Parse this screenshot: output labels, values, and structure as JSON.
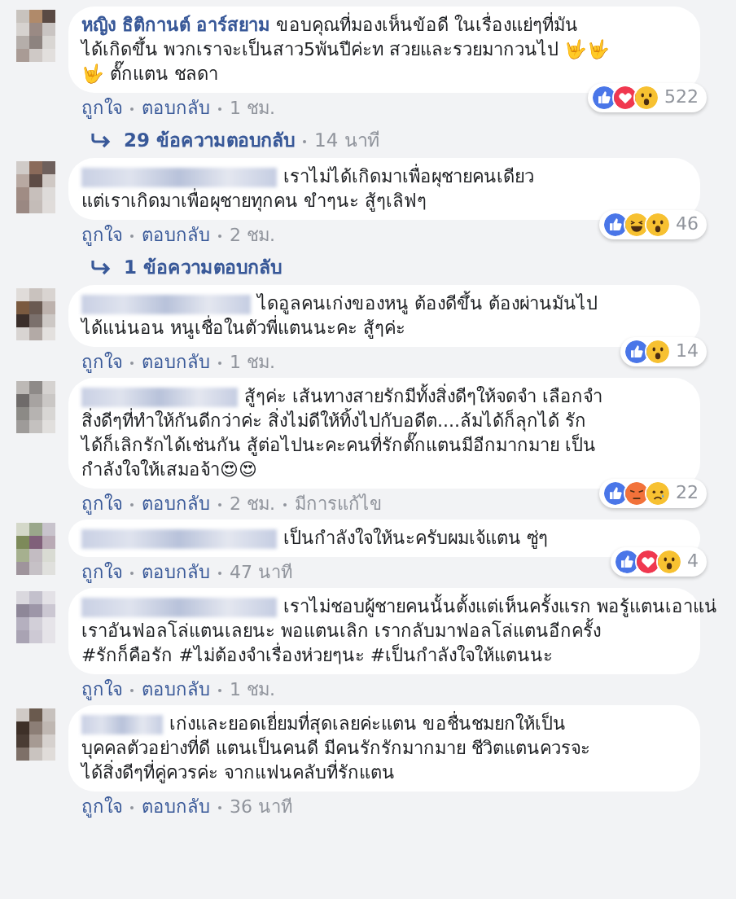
{
  "comments": [
    {
      "author": {
        "kind": "named",
        "name": "หญิง ธิติกานต์ อาร์สยาม"
      },
      "lines": [
        "ขอบคุณที่มองเห็นข้อดี ในเรื่องแย่ๆที่มัน",
        "ได้เกิดขึ้น พวกเราจะเป็นสาว5พันปีค่ะท สวยและรวยมากวนไป 🤟🤟",
        "🤟 ตั๊กแตน ชลดา"
      ],
      "reactions": [
        {
          "kind": "like"
        },
        {
          "kind": "love"
        },
        {
          "kind": "wow"
        }
      ],
      "reaction_count": "522",
      "like": "ถูกใจ",
      "reply": "ตอบกลับ",
      "time": "1 ชม.",
      "replies": {
        "count": "29 ข้อความตอบกลับ",
        "time": "14 นาที"
      }
    },
    {
      "author": {
        "kind": "blurred"
      },
      "lines": [
        "เราไม่ได้เกิดมาเพื่อผุชายคนเดียว",
        "แต่เราเกิดมาเพื่อผุชายทุกคน ขำๆนะ สู้ๆเลิฟๆ"
      ],
      "reactions": [
        {
          "kind": "like"
        },
        {
          "kind": "haha"
        },
        {
          "kind": "wow"
        }
      ],
      "reaction_count": "46",
      "like": "ถูกใจ",
      "reply": "ตอบกลับ",
      "time": "2 ชม.",
      "replies": {
        "count": "1 ข้อความตอบกลับ"
      }
    },
    {
      "author": {
        "kind": "blurred"
      },
      "lines": [
        "ไดอูลคนเก่งของหนู ต้องดีขึ้น ต้องผ่านมันไป",
        "ได้แน่นอน หนูเชื่อในตัวพี่แตนนะคะ สู้ๆค่ะ"
      ],
      "reactions": [
        {
          "kind": "like"
        },
        {
          "kind": "wow"
        }
      ],
      "reaction_count": "14",
      "like": "ถูกใจ",
      "reply": "ตอบกลับ",
      "time": "1 ชม."
    },
    {
      "author": {
        "kind": "blurred"
      },
      "lines": [
        "สู้ๆค่ะ เส้นทางสายรักมีทั้งสิ่งดีๆให้จดจำ เลือกจำ",
        "สิ่งดีๆที่ทำให้กันดีกว่าค่ะ สิ่งไม่ดีให้ทิ้งไปกับอดีต....ล้มได้ก็ลุกได้ รัก",
        "ได้ก็เลิกรักได้เช่นกัน สู้ต่อไปนะคะคนที่รักตั๊กแตนมีอีกมากมาย เป็น",
        "กำลังใจให้เสมอจ้า😍😍"
      ],
      "reactions": [
        {
          "kind": "like"
        },
        {
          "kind": "angry"
        },
        {
          "kind": "sad"
        }
      ],
      "reaction_count": "22",
      "like": "ถูกใจ",
      "reply": "ตอบกลับ",
      "time": "2 ชม.",
      "edited": "มีการแก้ไข"
    },
    {
      "author": {
        "kind": "blurred"
      },
      "lines": [
        "เป็นกำลังใจให้นะครับผมเจ้แตน ซู่ๆ"
      ],
      "reactions": [
        {
          "kind": "like"
        },
        {
          "kind": "love"
        },
        {
          "kind": "wow"
        }
      ],
      "reaction_count": "4",
      "like": "ถูกใจ",
      "reply": "ตอบกลับ",
      "time": "47 นาที"
    },
    {
      "author": {
        "kind": "blurred"
      },
      "lines": [
        "เราไม่ชอบผู้ชายคนนั้นตั้งแต่เห็นครั้งแรก พอรู้แตนเอาแน่",
        "เราอันฟอลโล่แตนเลยนะ พอแตนเลิก เรากลับมาฟอลโล่แตนอีกครั้ง",
        "#รักก็คือรัก #ไม่ต้องจำเรื่องห่วยๆนะ #เป็นกำลังใจให้แตนนะ"
      ],
      "like": "ถูกใจ",
      "reply": "ตอบกลับ",
      "time": "1 ชม."
    },
    {
      "author": {
        "kind": "blurred"
      },
      "lines": [
        "เก่งและยอดเยี่ยมที่สุดเลยค่ะแตน ขอชื่นชมยกให้เป็น",
        "บุคคลตัวอย่างที่ดี แตนเป็นคนดี มีคนรักรักมากมาย ชีวิตแตนควรจะ",
        "ได้สิ่งดีๆที่คู่ควรค่ะ จากแฟนคลับที่รักแตน"
      ],
      "like": "ถูกใจ",
      "reply": "ตอบกลับ",
      "time": "36 นาที"
    }
  ]
}
